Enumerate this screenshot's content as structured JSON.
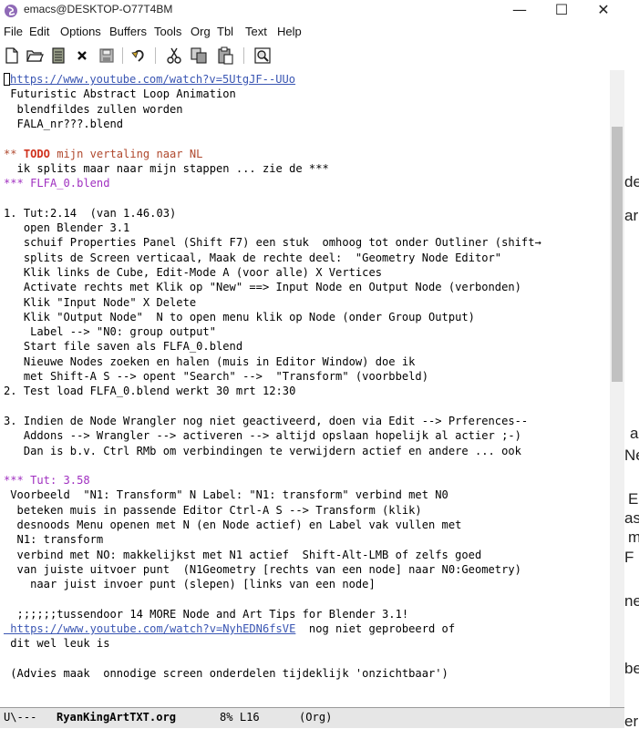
{
  "window": {
    "title": "emacs@DESKTOP-O77T4BM",
    "minimize_glyph": "—",
    "maximize_glyph": "☐",
    "close_glyph": "✕"
  },
  "menu": [
    "File",
    "Edit",
    "Options",
    "Buffers",
    "Tools",
    "Org",
    "Tbl",
    "Text",
    "Help"
  ],
  "toolbar_icons": [
    "new-file-icon",
    "open-folder-icon",
    "open-directory-icon",
    "close-buffer-icon",
    "save-icon",
    "undo-icon",
    "cut-icon",
    "copy-icon",
    "paste-icon",
    "search-icon"
  ],
  "buffer": {
    "lines": [
      {
        "t": "https://www.youtube.com/watch?v=5UtgJF--UUo",
        "s": "link",
        "cursor": true
      },
      {
        "t": " Futuristic Abstract Loop Animation",
        "s": ""
      },
      {
        "t": "  blendfildes zullen worden",
        "s": ""
      },
      {
        "t": "  FALA_nr???.blend",
        "s": ""
      },
      {
        "t": "",
        "s": ""
      },
      {
        "t": "** ",
        "s": "h2",
        "todo": "TODO",
        "rest": " mijn vertaling naar NL"
      },
      {
        "t": "  ik splits maar naar mijn stappen ... zie de ***",
        "s": ""
      },
      {
        "t": "*** FLFA_0.blend",
        "s": "h3"
      },
      {
        "t": "",
        "s": ""
      },
      {
        "t": "1. Tut:2.14  (van 1.46.03)",
        "s": ""
      },
      {
        "t": "   open Blender 3.1",
        "s": ""
      },
      {
        "t": "   schuif Properties Panel (Shift F7) een stuk  omhoog tot onder Outliner (shift→",
        "s": ""
      },
      {
        "t": "   splits de Screen verticaal, Maak de rechte deel:  \"Geometry Node Editor\"",
        "s": ""
      },
      {
        "t": "   Klik links de Cube, Edit-Mode A (voor alle) X Vertices",
        "s": ""
      },
      {
        "t": "   Activate rechts met Klik op \"New\" ==> Input Node en Output Node (verbonden)",
        "s": ""
      },
      {
        "t": "   Klik \"Input Node\" X Delete",
        "s": ""
      },
      {
        "t": "   Klik \"Output Node\"  N to open menu klik op Node (onder Group Output)",
        "s": ""
      },
      {
        "t": "    Label --> \"N0: group output\"",
        "s": ""
      },
      {
        "t": "   Start file saven als FLFA_0.blend",
        "s": ""
      },
      {
        "t": "   Nieuwe Nodes zoeken en halen (muis in Editor Window) doe ik",
        "s": ""
      },
      {
        "t": "   met Shift-A S --> opent \"Search\" -->  \"Transform\" (voorbbeld)",
        "s": ""
      },
      {
        "t": "2. Test load FLFA_0.blend werkt 30 mrt 12:30",
        "s": ""
      },
      {
        "t": "",
        "s": ""
      },
      {
        "t": "3. Indien de Node Wrangler nog niet geactiveerd, doen via Edit --> Prferences--",
        "s": ""
      },
      {
        "t": "   Addons --> Wrangler --> activeren --> altijd opslaan hopelijk al actier ;-)",
        "s": ""
      },
      {
        "t": "   Dan is b.v. Ctrl RMb om verbindingen te verwijdern actief en andere ... ook",
        "s": ""
      },
      {
        "t": "",
        "s": ""
      },
      {
        "t": "*** Tut: 3.58",
        "s": "h3"
      },
      {
        "t": " Voorbeeld  \"N1: Transform\" N Label: \"N1: transform\" verbind met N0",
        "s": ""
      },
      {
        "t": "  beteken muis in passende Editor Ctrl-A S --> Transform (klik)",
        "s": ""
      },
      {
        "t": "  desnoods Menu openen met N (en Node actief) en Label vak vullen met",
        "s": ""
      },
      {
        "t": "  N1: transform",
        "s": ""
      },
      {
        "t": "  verbind met NO: makkelijkst met N1 actief  Shift-Alt-LMB of zelfs goed",
        "s": ""
      },
      {
        "t": "  van juiste uitvoer punt  (N1Geometry [rechts van een node] naar N0:Geometry)",
        "s": ""
      },
      {
        "t": "    naar juist invoer punt (slepen) [links van een node]",
        "s": ""
      },
      {
        "t": "",
        "s": ""
      },
      {
        "t": "  ;;;;;;tussendoor 14 MORE Node and Art Tips for Blender 3.1!",
        "s": ""
      },
      {
        "t": " https://www.youtube.com/watch?v=NyhEDN6fsVE",
        "s": "link-indent",
        "rest": "  nog niet geprobeerd of"
      },
      {
        "t": " dit wel leuk is",
        "s": ""
      },
      {
        "t": "",
        "s": ""
      },
      {
        "t": " (Advies maak  onnodige screen onderdelen tijdeklijk 'onzichtbaar')",
        "s": ""
      }
    ]
  },
  "modeline": {
    "status": "U\\---",
    "buffer_name": "RyanKingArtTXT.org",
    "position": "8% L16",
    "mode": "(Org)"
  },
  "background_fragments": [
    "de",
    "ar",
    "a",
    "Ne",
    "E",
    "as",
    "m",
    "F",
    "ne",
    "be",
    "er"
  ],
  "colors": {
    "link": "#3a56b3",
    "todo": "#d0321e",
    "heading2": "#b0492e",
    "heading3": "#a030c0"
  }
}
